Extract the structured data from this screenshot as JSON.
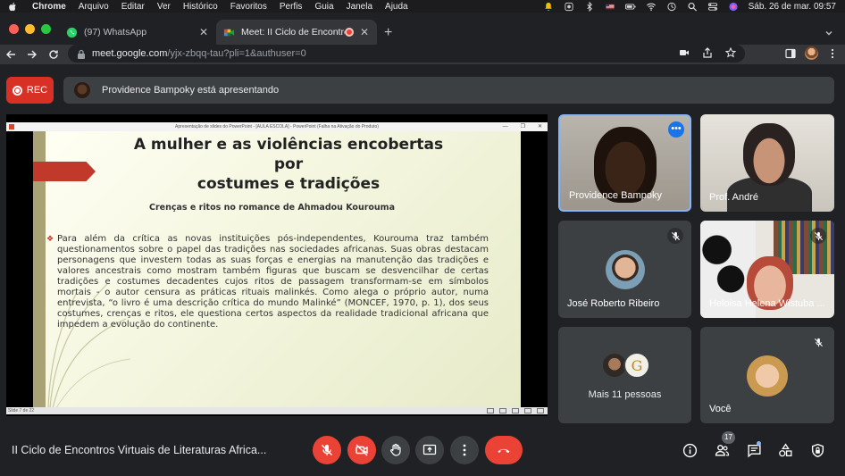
{
  "menubar": {
    "menus": [
      "Chrome",
      "Arquivo",
      "Editar",
      "Ver",
      "Histórico",
      "Favoritos",
      "Perfis",
      "Guia",
      "Janela",
      "Ajuda"
    ],
    "clock": "Sáb. 26 de mar.  09:57"
  },
  "tabs": [
    {
      "title": "(97) WhatsApp",
      "icon": "whatsapp-icon"
    },
    {
      "title": "Meet: II Ciclo de Encontros",
      "icon": "meet-icon"
    }
  ],
  "address_bar": {
    "host": "meet.google.com",
    "path": "/yjx-zbqq-tau?pli=1&authuser=0"
  },
  "banner": {
    "rec_label": "REC",
    "presenter_text": "Providence Bampoky está apresentando"
  },
  "ppt_window": {
    "title": "Apresentação de slides do PowerPoint - [AULA ESCOLA] - PowerPoint (Falha na Ativação do Produto)",
    "status": "Slide 7 de 22"
  },
  "slide": {
    "title_line1": "A mulher e as violências encobertas por",
    "title_line2": "costumes e tradições",
    "subtitle": "Crenças e ritos no romance de Ahmadou Kourouma",
    "bullet_marker": "❖",
    "body": "Para além da crítica as novas instituições pós-independentes, Kourouma traz também questionamentos sobre o papel das tradições nas sociedades africanas. Suas obras destacam personagens que investem todas as suas forças e energias na manutenção das tradições e valores ancestrais como mostram também figuras que buscam se desvencilhar de certas tradições e costumes decadentes cujos ritos de passagem transformam-se em símbolos mortais - o autor censura as práticas rituais malinkés. Como alega o próprio autor, numa entrevista, “o livro é uma descrição crítica do mundo Malinké” (MONCEF, 1970, p. 1), dos seus costumes, crenças e ritos, ele questiona certos aspectos da realidade tradicional africana que impedem a evolução do continente."
  },
  "participants": {
    "providence": "Providence Bampoky",
    "andre": "Prof. André",
    "jose": "José Roberto Ribeiro",
    "heloisa": "Heloisa Helena Wistuba ...",
    "more": "Mais 11 pessoas",
    "more_avatar_letter": "G",
    "you": "Você",
    "count_badge": "17"
  },
  "meeting": {
    "title": "II Ciclo de Encontros Virtuais de Literaturas Africa..."
  },
  "colors": {
    "meet_bg": "#202124",
    "tile_bg": "#3c4043",
    "danger": "#ea4335",
    "active_border": "#8ab4f8",
    "slide_arrow": "#c0392b"
  }
}
